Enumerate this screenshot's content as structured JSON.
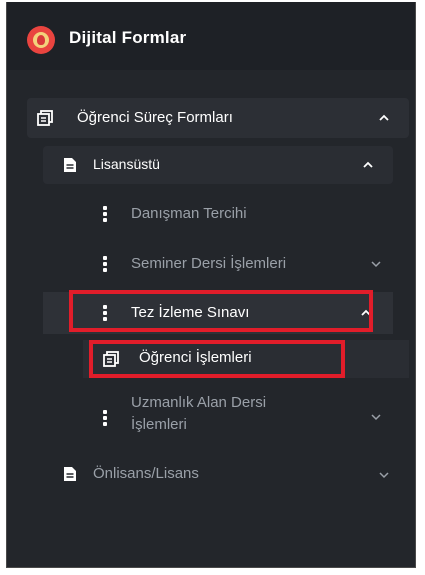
{
  "app": {
    "title": "Dijital Formlar"
  },
  "sidebar": {
    "group": {
      "label": "Öğrenci Süreç Formları",
      "icon": "form-icon",
      "expanded": true
    },
    "lisansustu": {
      "label": "Lisansüstü",
      "icon": "document-icon",
      "expanded": true
    },
    "items": [
      {
        "label": "Danışman Tercihi",
        "icon": "kebab-icon"
      },
      {
        "label": "Seminer Dersi İşlemleri",
        "icon": "kebab-icon",
        "expanded": false
      },
      {
        "label": "Tez İzleme Sınavı",
        "icon": "kebab-icon",
        "expanded": true,
        "highlighted": true
      },
      {
        "label": "Öğrenci İşlemleri",
        "icon": "form-icon",
        "highlighted": true,
        "selected": true
      },
      {
        "label_line1": "Uzmanlık Alan Dersi",
        "label_line2": "İşlemleri",
        "icon": "kebab-icon",
        "expanded": false
      }
    ],
    "onlisans": {
      "label": "Önlisans/Lisans",
      "icon": "document-icon",
      "expanded": false
    }
  },
  "colors": {
    "background": "#23262b",
    "text_active": "#ffffff",
    "text_muted": "#9aa0a8",
    "highlight_border": "#e11d2a",
    "logo_red": "#e9443f"
  }
}
